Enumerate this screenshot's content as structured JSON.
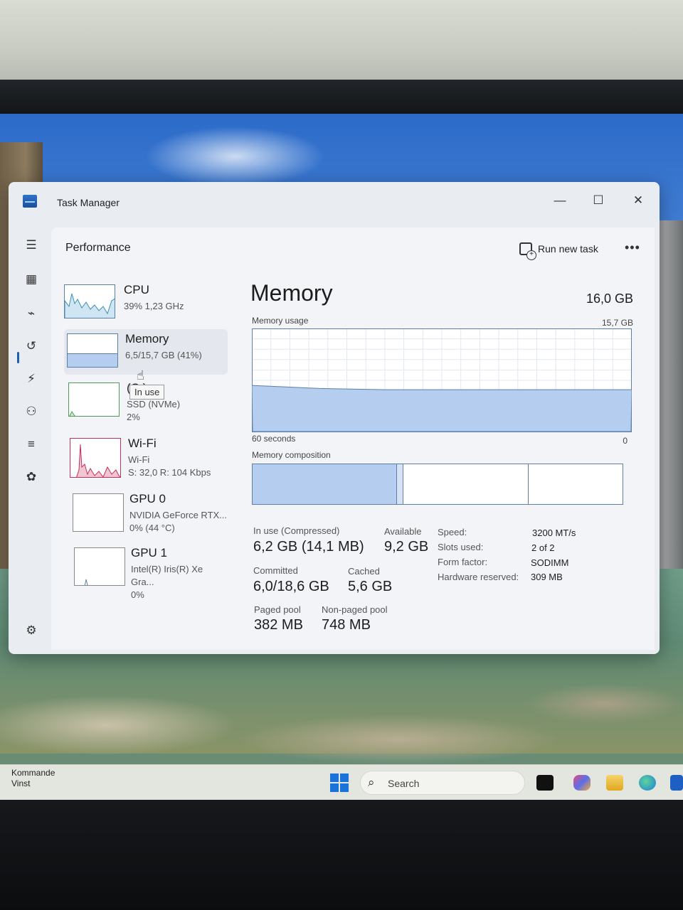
{
  "window": {
    "title": "Task Manager"
  },
  "header": {
    "page_title": "Performance",
    "run_new_task": "Run new task"
  },
  "devices": [
    {
      "name": "CPU",
      "sub1": "39%  1,23 GHz",
      "sub2": ""
    },
    {
      "name": "Memory",
      "sub1": "6,5/15,7 GB (41%)",
      "sub2": ""
    },
    {
      "name": "(C:)",
      "sub1": "SSD (NVMe)",
      "sub2": "2%"
    },
    {
      "name": "Wi-Fi",
      "sub1": "Wi-Fi",
      "sub2": "S: 32,0  R: 104 Kbps"
    },
    {
      "name": "GPU 0",
      "sub1": "NVIDIA GeForce RTX...",
      "sub2": "0%  (44 °C)"
    },
    {
      "name": "GPU 1",
      "sub1": "Intel(R) Iris(R) Xe Gra...",
      "sub2": "0%"
    }
  ],
  "tooltip": "In use",
  "memory": {
    "title": "Memory",
    "total": "16,0 GB",
    "usage_label": "Memory usage",
    "usage_max": "15,7 GB",
    "time_label": "60 seconds",
    "zero_label": "0",
    "composition_label": "Memory composition",
    "composition": {
      "in_use_fraction": 0.39,
      "modified_fraction": 0.017,
      "standby_fraction": 0.34
    },
    "usage_fraction": 0.41,
    "stats": {
      "in_use_label": "In use (Compressed)",
      "in_use": "6,2 GB (14,1 MB)",
      "available_label": "Available",
      "available": "9,2 GB",
      "committed_label": "Committed",
      "committed": "6,0/18,6 GB",
      "cached_label": "Cached",
      "cached": "5,6 GB",
      "paged_label": "Paged pool",
      "paged": "382 MB",
      "nonpaged_label": "Non-paged pool",
      "nonpaged": "748 MB"
    },
    "specs": {
      "speed_label": "Speed:",
      "speed": "3200 MT/s",
      "slots_label": "Slots used:",
      "slots": "2 of 2",
      "form_label": "Form factor:",
      "form": "SODIMM",
      "reserved_label": "Hardware reserved:",
      "reserved": "309 MB"
    }
  },
  "taskbar": {
    "notification_title": "Kommande",
    "notification_sub": "Vinst",
    "search_placeholder": "Search"
  },
  "colors": {
    "accent": "#1a5fb4",
    "memory_fill": "#b5cdee",
    "memory_line": "#5b7fa8",
    "wifi_line": "#c0305a"
  }
}
